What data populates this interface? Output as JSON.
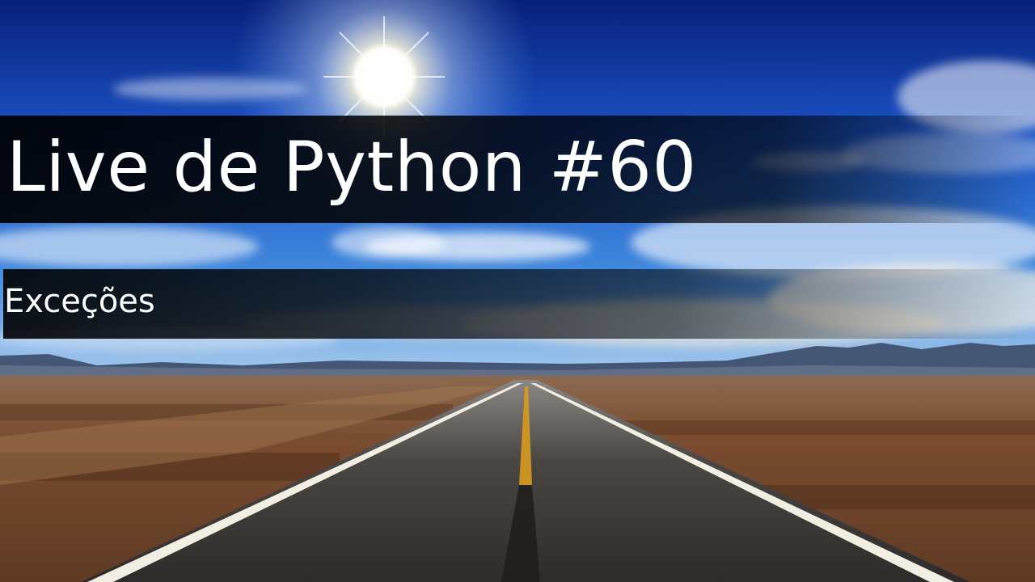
{
  "title": "Live de Python #60",
  "subtitle": "Exceções",
  "colors": {
    "sky_top": "#0a2a8a",
    "sky_mid": "#1f5fd0",
    "sky_horizon": "#9fc4ea",
    "ground": "#7a4a2a",
    "road": "#3b3836",
    "road_line_edge": "#f4f0e6",
    "road_line_center": "#e0a020",
    "mountain": "#3a4a6a",
    "text": "#ffffff"
  }
}
